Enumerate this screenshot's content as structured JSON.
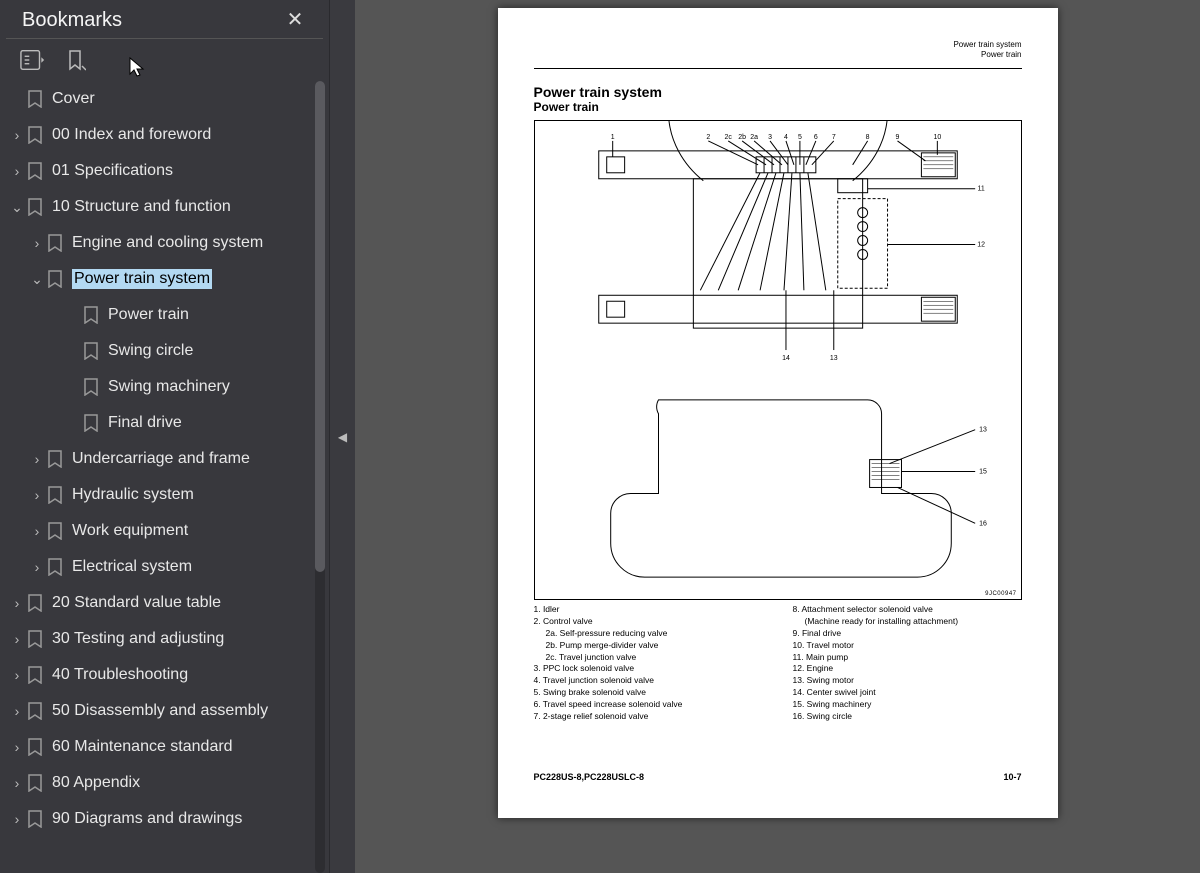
{
  "sidebar": {
    "title": "Bookmarks",
    "nodes": [
      {
        "label": "Cover",
        "depth": 0,
        "hasChildren": false,
        "expanded": false,
        "selected": false
      },
      {
        "label": "00 Index and foreword",
        "depth": 0,
        "hasChildren": true,
        "expanded": false,
        "selected": false
      },
      {
        "label": "01 Specifications",
        "depth": 0,
        "hasChildren": true,
        "expanded": false,
        "selected": false
      },
      {
        "label": "10 Structure and function",
        "depth": 0,
        "hasChildren": true,
        "expanded": true,
        "selected": false
      },
      {
        "label": "Engine and cooling system",
        "depth": 1,
        "hasChildren": true,
        "expanded": false,
        "selected": false
      },
      {
        "label": "Power train system",
        "depth": 1,
        "hasChildren": true,
        "expanded": true,
        "selected": true
      },
      {
        "label": "Power train",
        "depth": 2,
        "hasChildren": false,
        "expanded": false,
        "selected": false
      },
      {
        "label": "Swing circle",
        "depth": 2,
        "hasChildren": false,
        "expanded": false,
        "selected": false
      },
      {
        "label": "Swing machinery",
        "depth": 2,
        "hasChildren": false,
        "expanded": false,
        "selected": false
      },
      {
        "label": "Final drive",
        "depth": 2,
        "hasChildren": false,
        "expanded": false,
        "selected": false
      },
      {
        "label": "Undercarriage and frame",
        "depth": 1,
        "hasChildren": true,
        "expanded": false,
        "selected": false
      },
      {
        "label": "Hydraulic system",
        "depth": 1,
        "hasChildren": true,
        "expanded": false,
        "selected": false
      },
      {
        "label": "Work equipment",
        "depth": 1,
        "hasChildren": true,
        "expanded": false,
        "selected": false
      },
      {
        "label": "Electrical system",
        "depth": 1,
        "hasChildren": true,
        "expanded": false,
        "selected": false
      },
      {
        "label": "20 Standard value table",
        "depth": 0,
        "hasChildren": true,
        "expanded": false,
        "selected": false
      },
      {
        "label": "30 Testing and adjusting",
        "depth": 0,
        "hasChildren": true,
        "expanded": false,
        "selected": false
      },
      {
        "label": "40 Troubleshooting",
        "depth": 0,
        "hasChildren": true,
        "expanded": false,
        "selected": false
      },
      {
        "label": "50 Disassembly and assembly",
        "depth": 0,
        "hasChildren": true,
        "expanded": false,
        "selected": false
      },
      {
        "label": "60 Maintenance standard",
        "depth": 0,
        "hasChildren": true,
        "expanded": false,
        "selected": false
      },
      {
        "label": "80 Appendix",
        "depth": 0,
        "hasChildren": true,
        "expanded": false,
        "selected": false
      },
      {
        "label": "90 Diagrams and drawings",
        "depth": 0,
        "hasChildren": true,
        "expanded": false,
        "selected": false
      }
    ]
  },
  "doc": {
    "header_line1": "Power train system",
    "header_line2": "Power train",
    "h1": "Power train system",
    "h2": "Power train",
    "diagram_labels": [
      "1",
      "2",
      "2c",
      "2b",
      "2a",
      "3",
      "4",
      "5",
      "6",
      "7",
      "8",
      "9",
      "10",
      "11",
      "12",
      "13",
      "14",
      "15",
      "16"
    ],
    "diagram_id": "9JC00947",
    "legend_left": [
      {
        "t": "1. Idler",
        "sub": false
      },
      {
        "t": "2. Control valve",
        "sub": false
      },
      {
        "t": "2a. Self-pressure reducing valve",
        "sub": true
      },
      {
        "t": "2b. Pump merge-divider valve",
        "sub": true
      },
      {
        "t": "2c. Travel junction valve",
        "sub": true
      },
      {
        "t": "3. PPC lock solenoid valve",
        "sub": false
      },
      {
        "t": "4. Travel junction solenoid valve",
        "sub": false
      },
      {
        "t": "5. Swing brake solenoid valve",
        "sub": false
      },
      {
        "t": "6. Travel speed increase solenoid valve",
        "sub": false
      },
      {
        "t": "7. 2-stage relief solenoid valve",
        "sub": false
      }
    ],
    "legend_right": [
      {
        "t": "8. Attachment selector solenoid valve",
        "sub": false
      },
      {
        "t": "(Machine ready for installing attachment)",
        "sub": true
      },
      {
        "t": "9. Final drive",
        "sub": false
      },
      {
        "t": "10. Travel motor",
        "sub": false
      },
      {
        "t": "11. Main pump",
        "sub": false
      },
      {
        "t": "12. Engine",
        "sub": false
      },
      {
        "t": "13. Swing motor",
        "sub": false
      },
      {
        "t": "14. Center swivel joint",
        "sub": false
      },
      {
        "t": "15. Swing machinery",
        "sub": false
      },
      {
        "t": "16. Swing circle",
        "sub": false
      }
    ],
    "footer_left": "PC228US-8,PC228USLC-8",
    "footer_right": "10-7"
  }
}
